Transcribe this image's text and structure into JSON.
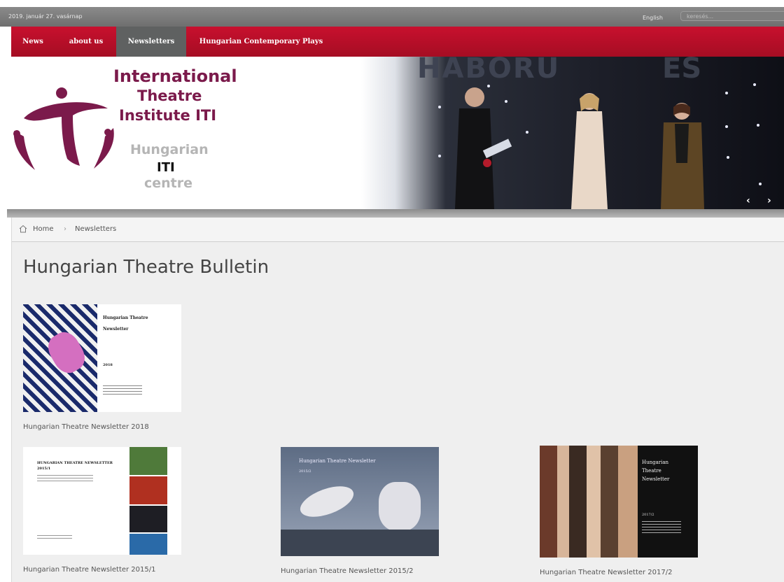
{
  "topbar": {
    "date": "2019. január 27. vasárnap",
    "language": "English",
    "search_placeholder": "keresés..."
  },
  "nav": {
    "items": [
      {
        "label": "News"
      },
      {
        "label": "about us"
      },
      {
        "label": "Newsletters",
        "active": true
      },
      {
        "label": "Hungarian Contemporary Plays"
      }
    ]
  },
  "logo": {
    "line1": "International",
    "line2": "Theatre",
    "line3": "Institute ITI",
    "line4": "Hungarian",
    "line5": "ITI",
    "line6": "centre"
  },
  "banner": {
    "backdrop_text": "HÁBORÚ",
    "backdrop_text2": "ÉS"
  },
  "breadcrumb": {
    "home": "Home",
    "current": "Newsletters"
  },
  "page": {
    "title": "Hungarian Theatre Bulletin"
  },
  "newsletters": [
    {
      "caption": "Hungarian Theatre Newsletter 2018",
      "cover_title_1": "Hungarian Theatre",
      "cover_title_2": "Newsletter",
      "cover_year": "2018"
    },
    {
      "caption": "Hungarian Theatre Newsletter 2015/1",
      "cover_title": "HUNGARIAN THEATRE NEWSLETTER",
      "cover_issue": "2015/1"
    },
    {
      "caption": "Hungarian Theatre Newsletter 2015/2",
      "cover_title": "Hungarian Theatre Newsletter",
      "cover_issue": "2015/2"
    },
    {
      "caption": "Hungarian Theatre Newsletter 2017/2",
      "cover_title_1": "Hungarian",
      "cover_title_2": "Theatre",
      "cover_title_3": "Newsletter",
      "cover_issue": "2017/2"
    }
  ],
  "colors": {
    "nav_red": "#c8102e",
    "nav_active": "#5f6161",
    "logo_burgundy": "#7b1a4b"
  }
}
